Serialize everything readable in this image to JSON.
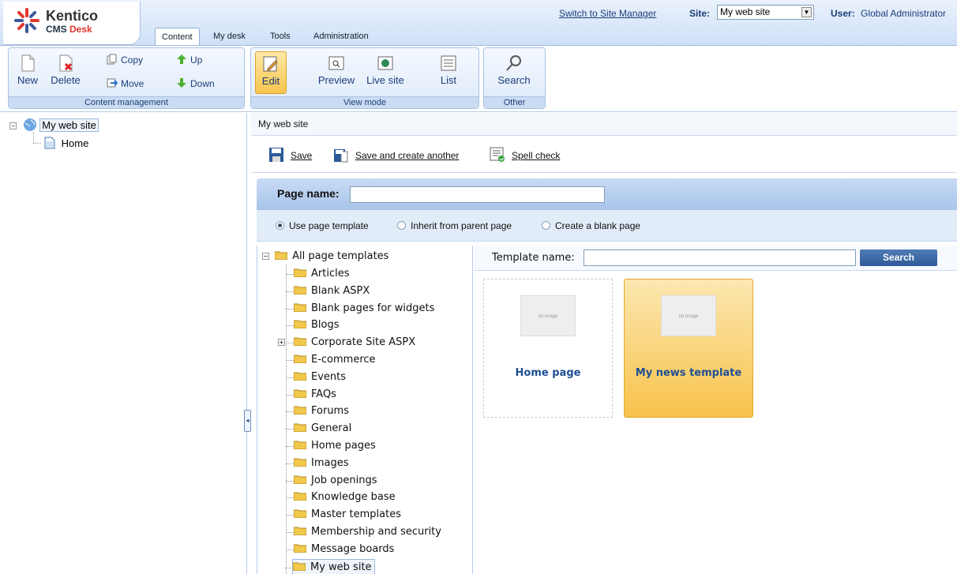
{
  "header": {
    "logo_name": "Kentico",
    "logo_sub_a": "CMS",
    "logo_sub_b": "Desk",
    "tabs": [
      "Content",
      "My desk",
      "Tools",
      "Administration"
    ],
    "switch_link": "Switch to Site Manager",
    "site_label": "Site:",
    "site_value": "My web site",
    "user_label": "User:",
    "user_value": "Global Administrator"
  },
  "ribbon": {
    "content_management": {
      "label": "Content management",
      "new": "New",
      "delete": "Delete",
      "copy": "Copy",
      "move": "Move",
      "up": "Up",
      "down": "Down"
    },
    "view_mode": {
      "label": "View mode",
      "edit": "Edit",
      "preview": "Preview",
      "live_site": "Live site",
      "list": "List"
    },
    "other": {
      "label": "Other",
      "search": "Search"
    }
  },
  "tree": {
    "root": "My web site",
    "child": "Home"
  },
  "breadcrumb": "My web site",
  "actions": {
    "save": "Save",
    "save_create": "Save and create another",
    "spell": "Spell check"
  },
  "page_name": {
    "label": "Page name:",
    "value": ""
  },
  "options": {
    "use_template": "Use page template",
    "inherit": "Inherit from parent page",
    "blank": "Create a blank page"
  },
  "templates": {
    "root": "All page templates",
    "items": [
      "Articles",
      "Blank ASPX",
      "Blank pages for widgets",
      "Blogs",
      "Corporate Site ASPX",
      "E-commerce",
      "Events",
      "FAQs",
      "Forums",
      "General",
      "Home pages",
      "Images",
      "Job openings",
      "Knowledge base",
      "Master templates",
      "Membership and security",
      "Message boards",
      "My web site"
    ],
    "search_label": "Template name:",
    "search_value": "",
    "search_button": "Search",
    "no_image": "no image",
    "cards": [
      "Home page",
      "My news template"
    ]
  }
}
